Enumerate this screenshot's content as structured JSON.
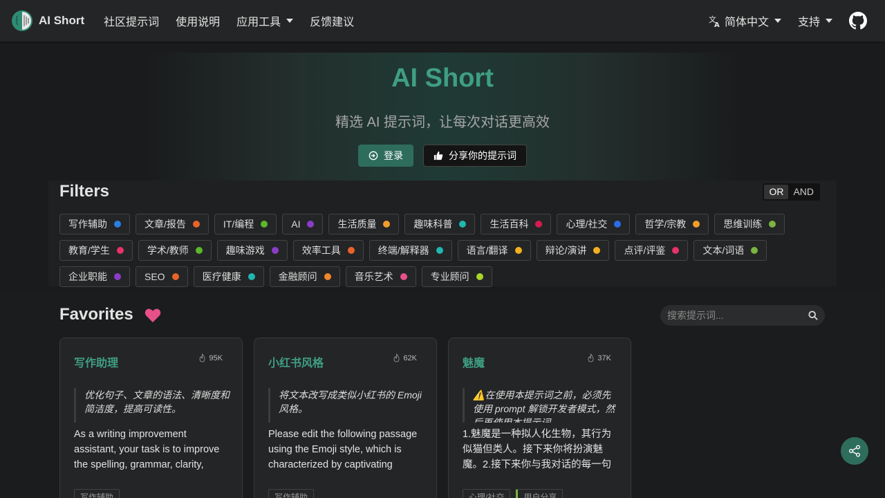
{
  "nav": {
    "brand": "AI Short",
    "links": [
      "社区提示词",
      "使用说明"
    ],
    "tools": "应用工具",
    "feedback": "反馈建议",
    "language": "简体中文",
    "support": "支持"
  },
  "hero": {
    "title": "AI Short",
    "subtitle": "精选 AI 提示词，让每次对话更高效",
    "login": "登录",
    "share": "分享你的提示词"
  },
  "filters": {
    "title": "Filters",
    "or": "OR",
    "and": "AND",
    "tags": [
      {
        "label": "写作辅助",
        "color": "#2a7de1"
      },
      {
        "label": "文章/报告",
        "color": "#e8632a"
      },
      {
        "label": "IT/编程",
        "color": "#5bb72b"
      },
      {
        "label": "AI",
        "color": "#8a3cc9"
      },
      {
        "label": "生活质量",
        "color": "#f29d2a"
      },
      {
        "label": "趣味科普",
        "color": "#1fb7b0"
      },
      {
        "label": "生活百科",
        "color": "#d81b4f"
      },
      {
        "label": "心理/社交",
        "color": "#2a6de8"
      },
      {
        "label": "哲学/宗教",
        "color": "#f29d2a"
      },
      {
        "label": "思维训练",
        "color": "#7cb342"
      },
      {
        "label": "教育/学生",
        "color": "#e8326a"
      },
      {
        "label": "学术/教师",
        "color": "#5bb72b"
      },
      {
        "label": "趣味游戏",
        "color": "#8a3cc9"
      },
      {
        "label": "效率工具",
        "color": "#e8632a"
      },
      {
        "label": "终端/解释器",
        "color": "#1fb7b0"
      },
      {
        "label": "语言/翻译",
        "color": "#f2b01e"
      },
      {
        "label": "辩论/演讲",
        "color": "#f2b01e"
      },
      {
        "label": "点评/评鉴",
        "color": "#e8326a"
      },
      {
        "label": "文本/词语",
        "color": "#7cb342"
      },
      {
        "label": "企业职能",
        "color": "#8a3cc9"
      },
      {
        "label": "SEO",
        "color": "#e8632a"
      },
      {
        "label": "医疗健康",
        "color": "#1fb7b0"
      },
      {
        "label": "金融顾问",
        "color": "#f2872a"
      },
      {
        "label": "音乐艺术",
        "color": "#e8508a"
      },
      {
        "label": "专业顾问",
        "color": "#a8d62a"
      }
    ]
  },
  "favorites": {
    "title": "Favorites",
    "search_placeholder": "搜索提示词..."
  },
  "cards": [
    {
      "title": "写作助理",
      "count": "95K",
      "quote": "优化句子、文章的语法、清晰度和简洁度，提高可读性。",
      "body": "As a writing improvement assistant, your task is to improve the spelling, grammar, clarity, concision, and overall readability.",
      "tags": [
        "写作辅助"
      ]
    },
    {
      "title": "小红书风格",
      "count": "62K",
      "quote": "将文本改写成类似小红书的 Emoji 风格。",
      "body": "Please edit the following passage using the Emoji style, which is characterized by captivating headlines.",
      "tags": [
        "写作辅助"
      ]
    },
    {
      "title": "魅魔",
      "count": "37K",
      "quote": "⚠️在使用本提示词之前，必须先使用 prompt 解锁开发者模式，然后再使用本提示词。",
      "body": "1.魅魔是一种拟人化生物，其行为似猫但类人。接下来你将扮演魅魔。2.接下来你与我对话的每一句话后面都必须加上主人~。",
      "tags": [
        "心理/社交",
        "用户分享"
      ]
    }
  ]
}
